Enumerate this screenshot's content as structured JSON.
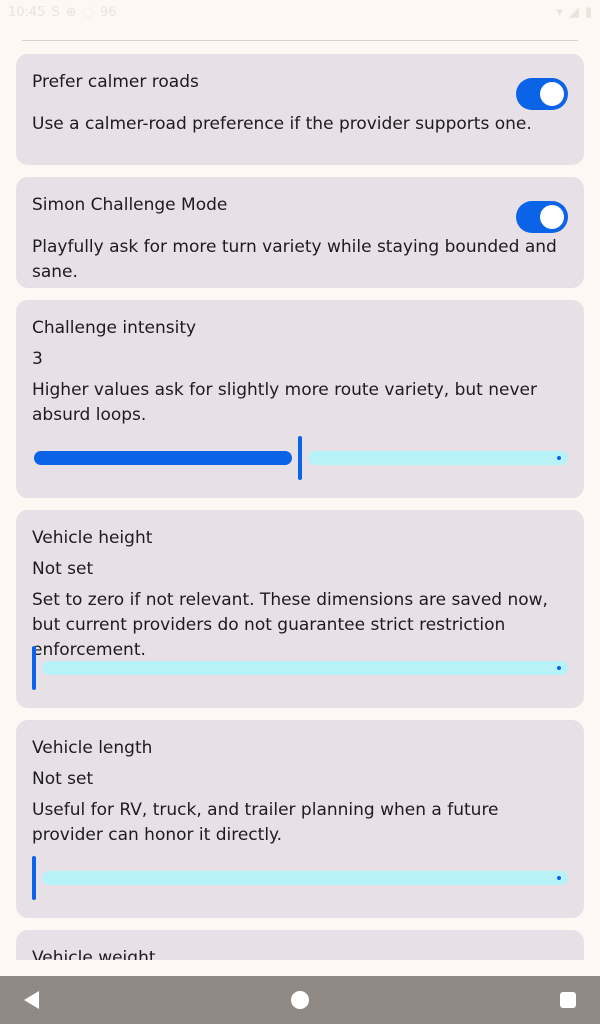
{
  "status_bar": {
    "time": "10:45",
    "left_icons": [
      "S",
      "⊕",
      "◌",
      "96"
    ],
    "right_icons": [
      "▾",
      "◢",
      "▮"
    ]
  },
  "settings": {
    "calmer_roads": {
      "title": "Prefer calmer roads",
      "description": "Use a calmer-road preference if the provider supports one.",
      "enabled": true
    },
    "simon_mode": {
      "title": "Simon Challenge Mode",
      "description": "Playfully ask for more turn variety while staying bounded and sane.",
      "enabled": true
    },
    "challenge_intensity": {
      "title": "Challenge intensity",
      "value": "3",
      "description": "Higher values ask for slightly more route variety, but never absurd loops.",
      "fraction": 0.5
    },
    "vehicle_height": {
      "title": "Vehicle height",
      "value": "Not set",
      "description": "Set to zero if not relevant. These dimensions are saved now, but current providers do not guarantee strict restriction enforcement.",
      "fraction": 0
    },
    "vehicle_length": {
      "title": "Vehicle length",
      "value": "Not set",
      "description": "Useful for RV, truck, and trailer planning when a future provider can honor it directly.",
      "fraction": 0
    },
    "vehicle_weight": {
      "title": "Vehicle weight"
    }
  },
  "colors": {
    "accent": "#0b63e8",
    "track_inactive": "#b7f2f7",
    "card_bg": "#e7e0e6",
    "page_bg": "#fdf8f3"
  },
  "nav": {
    "back": "back-icon",
    "home": "home-icon",
    "recents": "recents-icon"
  }
}
